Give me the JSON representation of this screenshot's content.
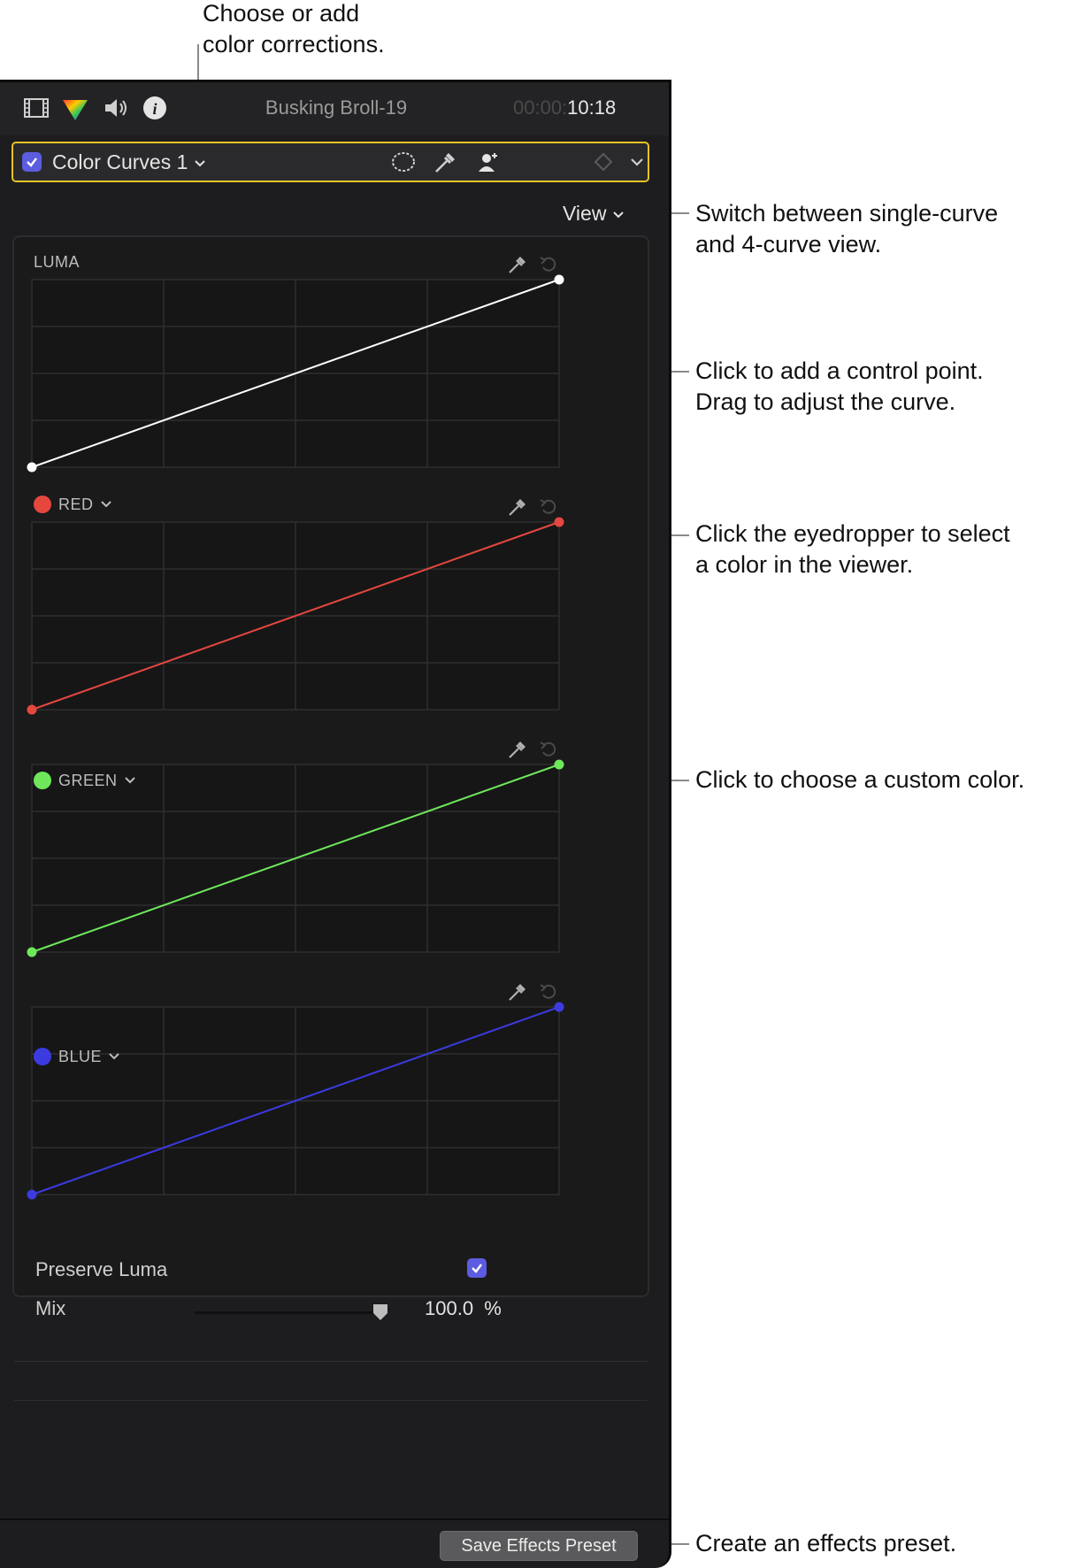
{
  "callouts": {
    "color_corrections": "Choose or add\ncolor corrections.",
    "view_switch": "Switch between single-curve\nand 4-curve view.",
    "control_point": "Click to add a control point.\nDrag to adjust the curve.",
    "eyedropper": "Click the eyedropper to select\na color in the viewer.",
    "custom_color": "Click to choose a custom color.",
    "effects_preset": "Create an effects preset."
  },
  "topbar": {
    "clip_name": "Busking Broll-19",
    "timecode_dim": "00:00:",
    "timecode": "10:18"
  },
  "effect": {
    "name": "Color Curves 1",
    "enabled": true
  },
  "view_button": "View",
  "curves": [
    {
      "label": "LUMA",
      "color": "#ffffff"
    },
    {
      "label": "RED",
      "color": "#e5473f"
    },
    {
      "label": "GREEN",
      "color": "#6ee85a"
    },
    {
      "label": "BLUE",
      "color": "#3b3be0"
    }
  ],
  "preserve_luma": {
    "label": "Preserve Luma",
    "checked": true
  },
  "mix": {
    "label": "Mix",
    "value": "100.0",
    "unit": "%",
    "fraction": 1.0
  },
  "save_preset": "Save Effects Preset",
  "colors": {
    "accent": "#5c5ce0",
    "highlight": "#e6c326"
  }
}
